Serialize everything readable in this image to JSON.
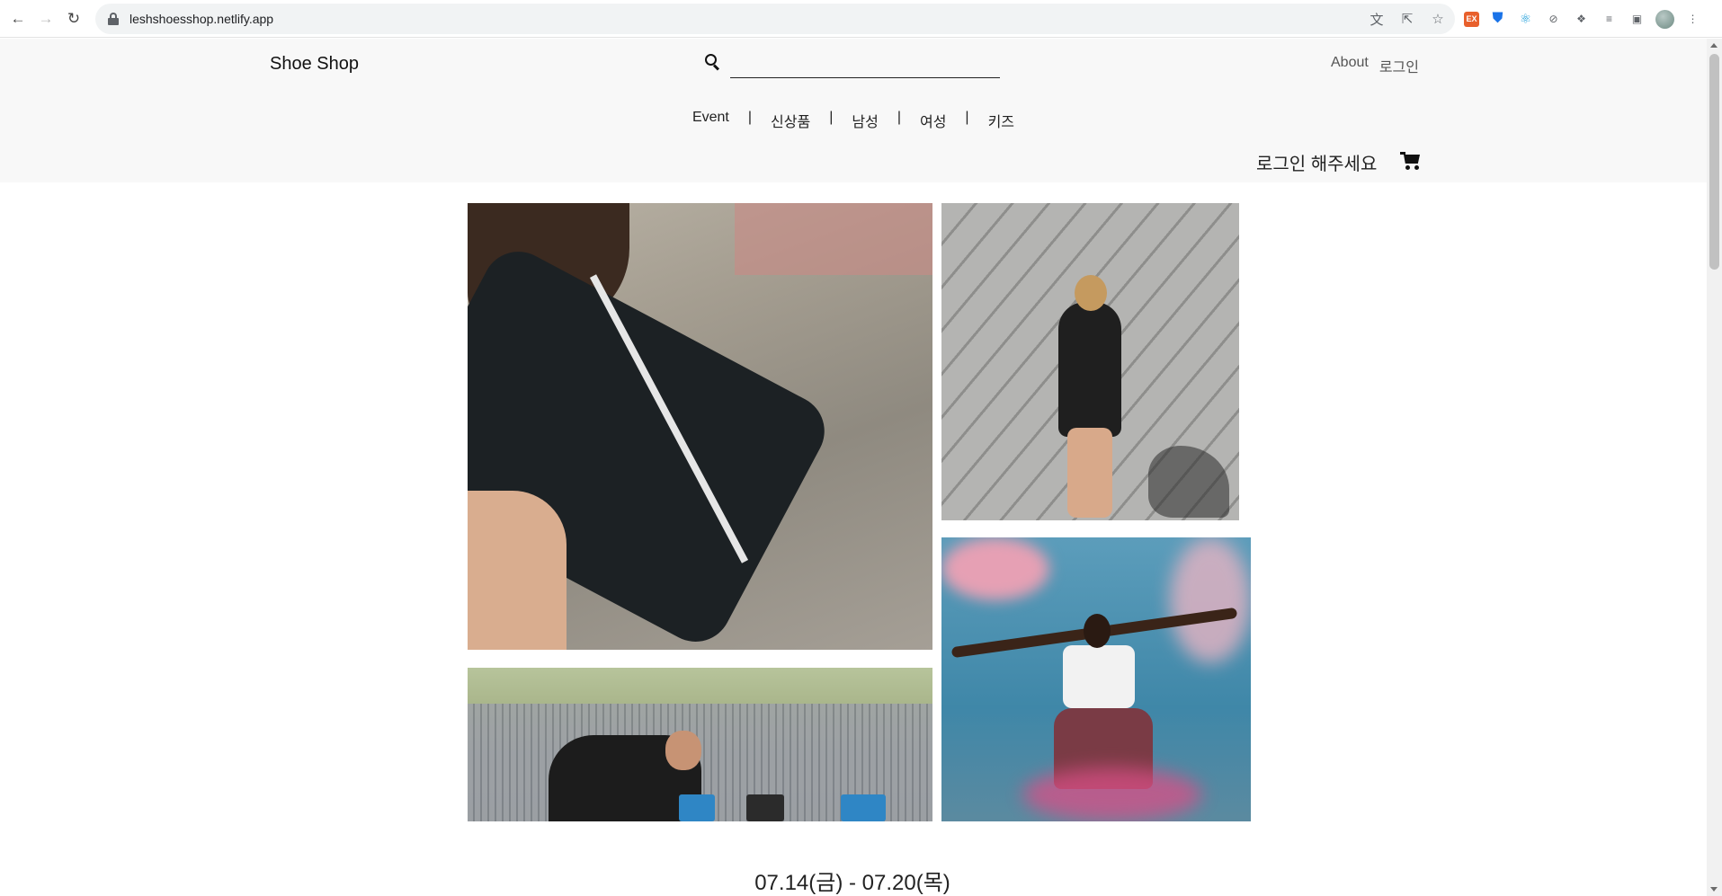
{
  "browser": {
    "url": "leshshoesshop.netlify.app",
    "back_icon": "arrow-left-icon",
    "forward_icon": "arrow-right-icon",
    "reload_icon": "reload-icon",
    "omnibox_icons": [
      "translate-icon",
      "share-icon",
      "star-icon"
    ],
    "extension_icons": [
      "ex-extension-icon",
      "shield-extension-icon",
      "react-extension-icon",
      "compass-extension-icon",
      "puzzle-icon",
      "media-icon",
      "sidebar-icon",
      "profile-avatar",
      "kebab-menu-icon"
    ]
  },
  "header": {
    "brand": "Shoe Shop",
    "search_placeholder": "",
    "links": {
      "about": "About",
      "login": "로그인"
    },
    "nav": [
      {
        "label": "Event"
      },
      {
        "label": "신상품"
      },
      {
        "label": "남성"
      },
      {
        "label": "여성"
      },
      {
        "label": "키즈"
      }
    ],
    "nav_separator": "|",
    "login_prompt": "로그인 해주세요"
  },
  "event": {
    "date_range": "07.14(금) - 07.20(목)"
  },
  "colors": {
    "header_bg": "#f8f8f8",
    "text": "#222222",
    "link": "#555555"
  }
}
